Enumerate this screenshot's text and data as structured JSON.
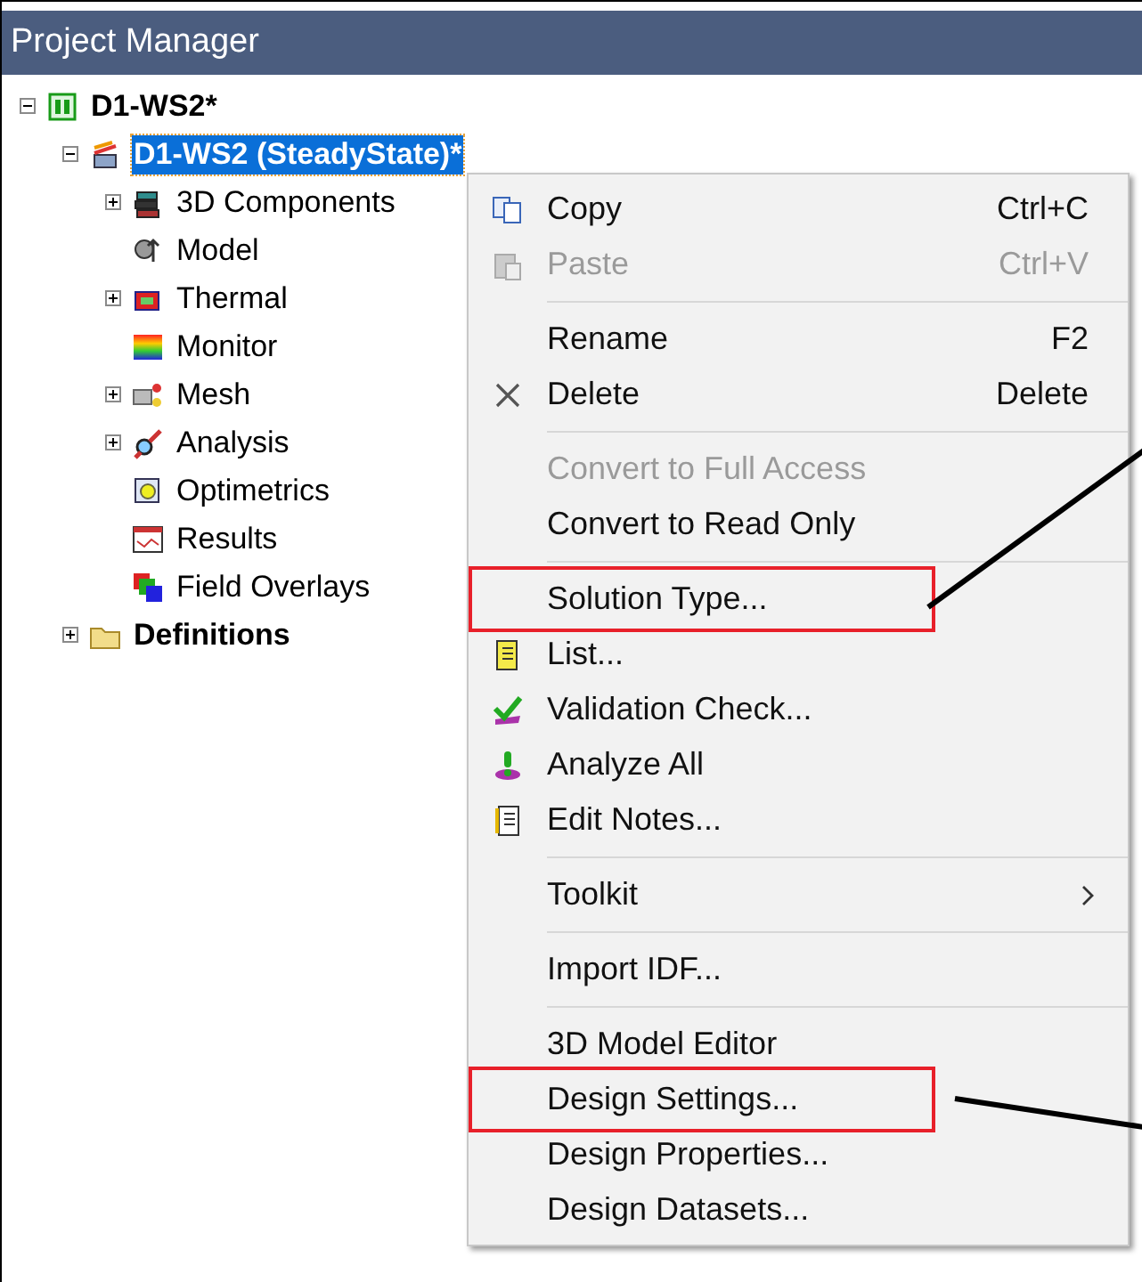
{
  "window": {
    "title": "Project Manager"
  },
  "tree": [
    {
      "label": "D1-WS2*",
      "expanded": true,
      "selected": false,
      "children": [
        {
          "label": "D1-WS2 (SteadyState)*",
          "expanded": true,
          "selected": true,
          "children": [
            {
              "label": "3D Components",
              "expanded": false,
              "selected": false
            },
            {
              "label": "Model",
              "selected": false
            },
            {
              "label": "Thermal",
              "expanded": false,
              "selected": false
            },
            {
              "label": "Monitor",
              "selected": false
            },
            {
              "label": "Mesh",
              "expanded": false,
              "selected": false
            },
            {
              "label": "Analysis",
              "expanded": false,
              "selected": false
            },
            {
              "label": "Optimetrics",
              "selected": false
            },
            {
              "label": "Results",
              "selected": false
            },
            {
              "label": "Field Overlays",
              "selected": false
            }
          ]
        },
        {
          "label": "Definitions",
          "expanded": false,
          "selected": false
        }
      ]
    }
  ],
  "context_menu": [
    {
      "kind": "item",
      "label": "Copy",
      "shortcut": "Ctrl+C",
      "disabled": false,
      "highlighted": false
    },
    {
      "kind": "item",
      "label": "Paste",
      "shortcut": "Ctrl+V",
      "disabled": true,
      "highlighted": false
    },
    {
      "kind": "separator"
    },
    {
      "kind": "item",
      "label": "Rename",
      "shortcut": "F2",
      "disabled": false,
      "highlighted": false
    },
    {
      "kind": "item",
      "label": "Delete",
      "shortcut": "Delete",
      "disabled": false,
      "highlighted": false
    },
    {
      "kind": "separator"
    },
    {
      "kind": "item",
      "label": "Convert to Full Access",
      "disabled": true,
      "highlighted": false
    },
    {
      "kind": "item",
      "label": "Convert to Read Only",
      "disabled": false,
      "highlighted": false
    },
    {
      "kind": "separator"
    },
    {
      "kind": "item",
      "label": "Solution Type...",
      "disabled": false,
      "highlighted": true
    },
    {
      "kind": "item",
      "label": "List...",
      "disabled": false,
      "highlighted": false
    },
    {
      "kind": "item",
      "label": "Validation Check...",
      "disabled": false,
      "highlighted": false
    },
    {
      "kind": "item",
      "label": "Analyze All",
      "disabled": false,
      "highlighted": false
    },
    {
      "kind": "item",
      "label": "Edit Notes...",
      "disabled": false,
      "highlighted": false
    },
    {
      "kind": "separator"
    },
    {
      "kind": "submenu",
      "label": "Toolkit",
      "disabled": false,
      "highlighted": false
    },
    {
      "kind": "separator"
    },
    {
      "kind": "item",
      "label": "Import IDF...",
      "disabled": false,
      "highlighted": false
    },
    {
      "kind": "separator"
    },
    {
      "kind": "item",
      "label": "3D Model Editor",
      "disabled": false,
      "highlighted": false
    },
    {
      "kind": "item",
      "label": "Design Settings...",
      "disabled": false,
      "highlighted": true
    },
    {
      "kind": "item",
      "label": "Design Properties...",
      "disabled": false,
      "highlighted": false
    },
    {
      "kind": "item",
      "label": "Design Datasets...",
      "disabled": false,
      "highlighted": false
    }
  ]
}
